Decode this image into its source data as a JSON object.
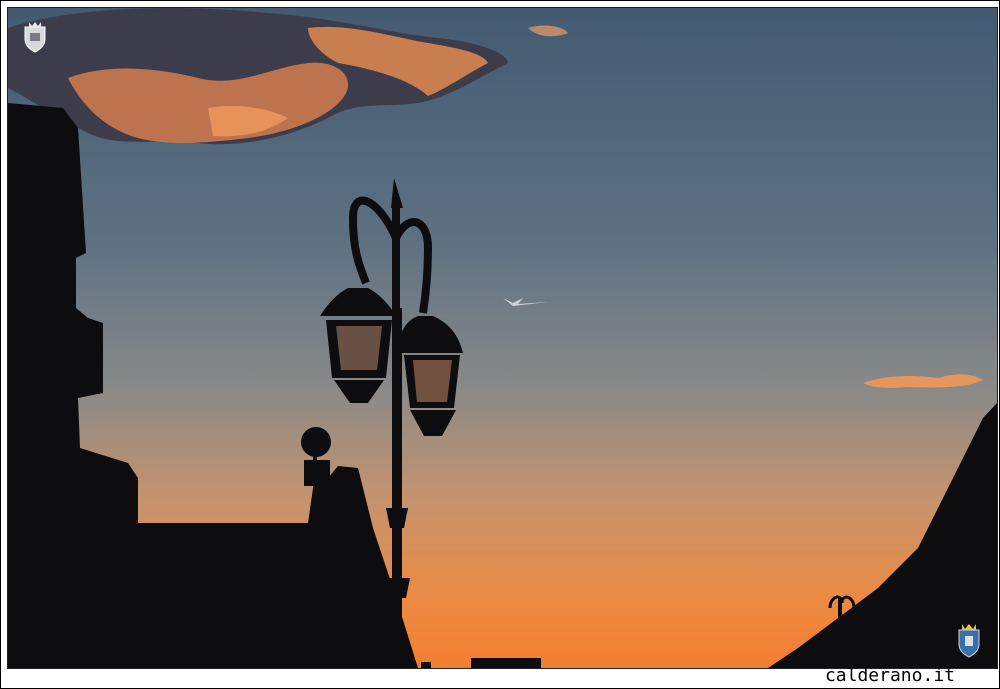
{
  "watermark": {
    "text": "calderano.it",
    "crest_top_left": "coat-of-arms-icon",
    "crest_bottom_right": "coat-of-arms-icon"
  },
  "photo": {
    "colors": {
      "sky_top": "#4a6178",
      "sky_mid": "#6a7d8a",
      "sky_low": "#c99a74",
      "horizon": "#f08a3c",
      "cloud": "#e88a55",
      "silhouette": "#0d0d10"
    }
  }
}
